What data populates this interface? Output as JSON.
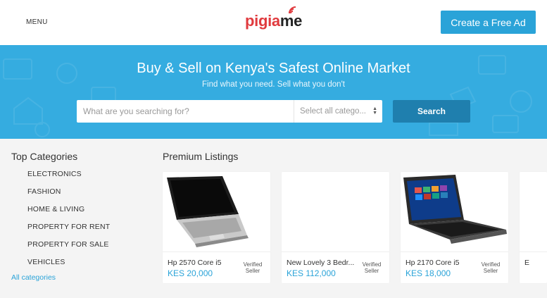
{
  "header": {
    "menu_label": "MENU",
    "logo_left": "pigia",
    "logo_right": "me",
    "cta_label": "Create a Free Ad"
  },
  "hero": {
    "title": "Buy & Sell on Kenya's Safest Online Market",
    "subtitle": "Find what you need. Sell what you don't",
    "search_placeholder": "What are you searching for?",
    "category_select": "Select all catego...",
    "search_button": "Search"
  },
  "sidebar": {
    "title": "Top Categories",
    "items": [
      {
        "label": "ELECTRONICS"
      },
      {
        "label": "FASHION"
      },
      {
        "label": "HOME & LIVING"
      },
      {
        "label": "PROPERTY FOR RENT"
      },
      {
        "label": "PROPERTY FOR SALE"
      },
      {
        "label": "VEHICLES"
      }
    ],
    "all_link": "All categories"
  },
  "listings": {
    "title": "Premium Listings",
    "cards": [
      {
        "name": "Hp 2570 Core i5",
        "price": "KES 20,000",
        "badge": "Verified Seller",
        "image": "laptop-closed"
      },
      {
        "name": "New Lovely 3 Bedr...",
        "price": "KES 112,000",
        "badge": "Verified Seller",
        "image": "blank"
      },
      {
        "name": "Hp 2170 Core i5",
        "price": "KES 18,000",
        "badge": "Verified Seller",
        "image": "laptop-windows"
      },
      {
        "name": "E",
        "price": "",
        "badge": "",
        "image": "blank"
      }
    ]
  },
  "colors": {
    "brand_blue": "#2aa3d8",
    "hero_blue": "#35ace0",
    "search_button": "#1f7fae",
    "logo_red": "#e03a3e"
  }
}
